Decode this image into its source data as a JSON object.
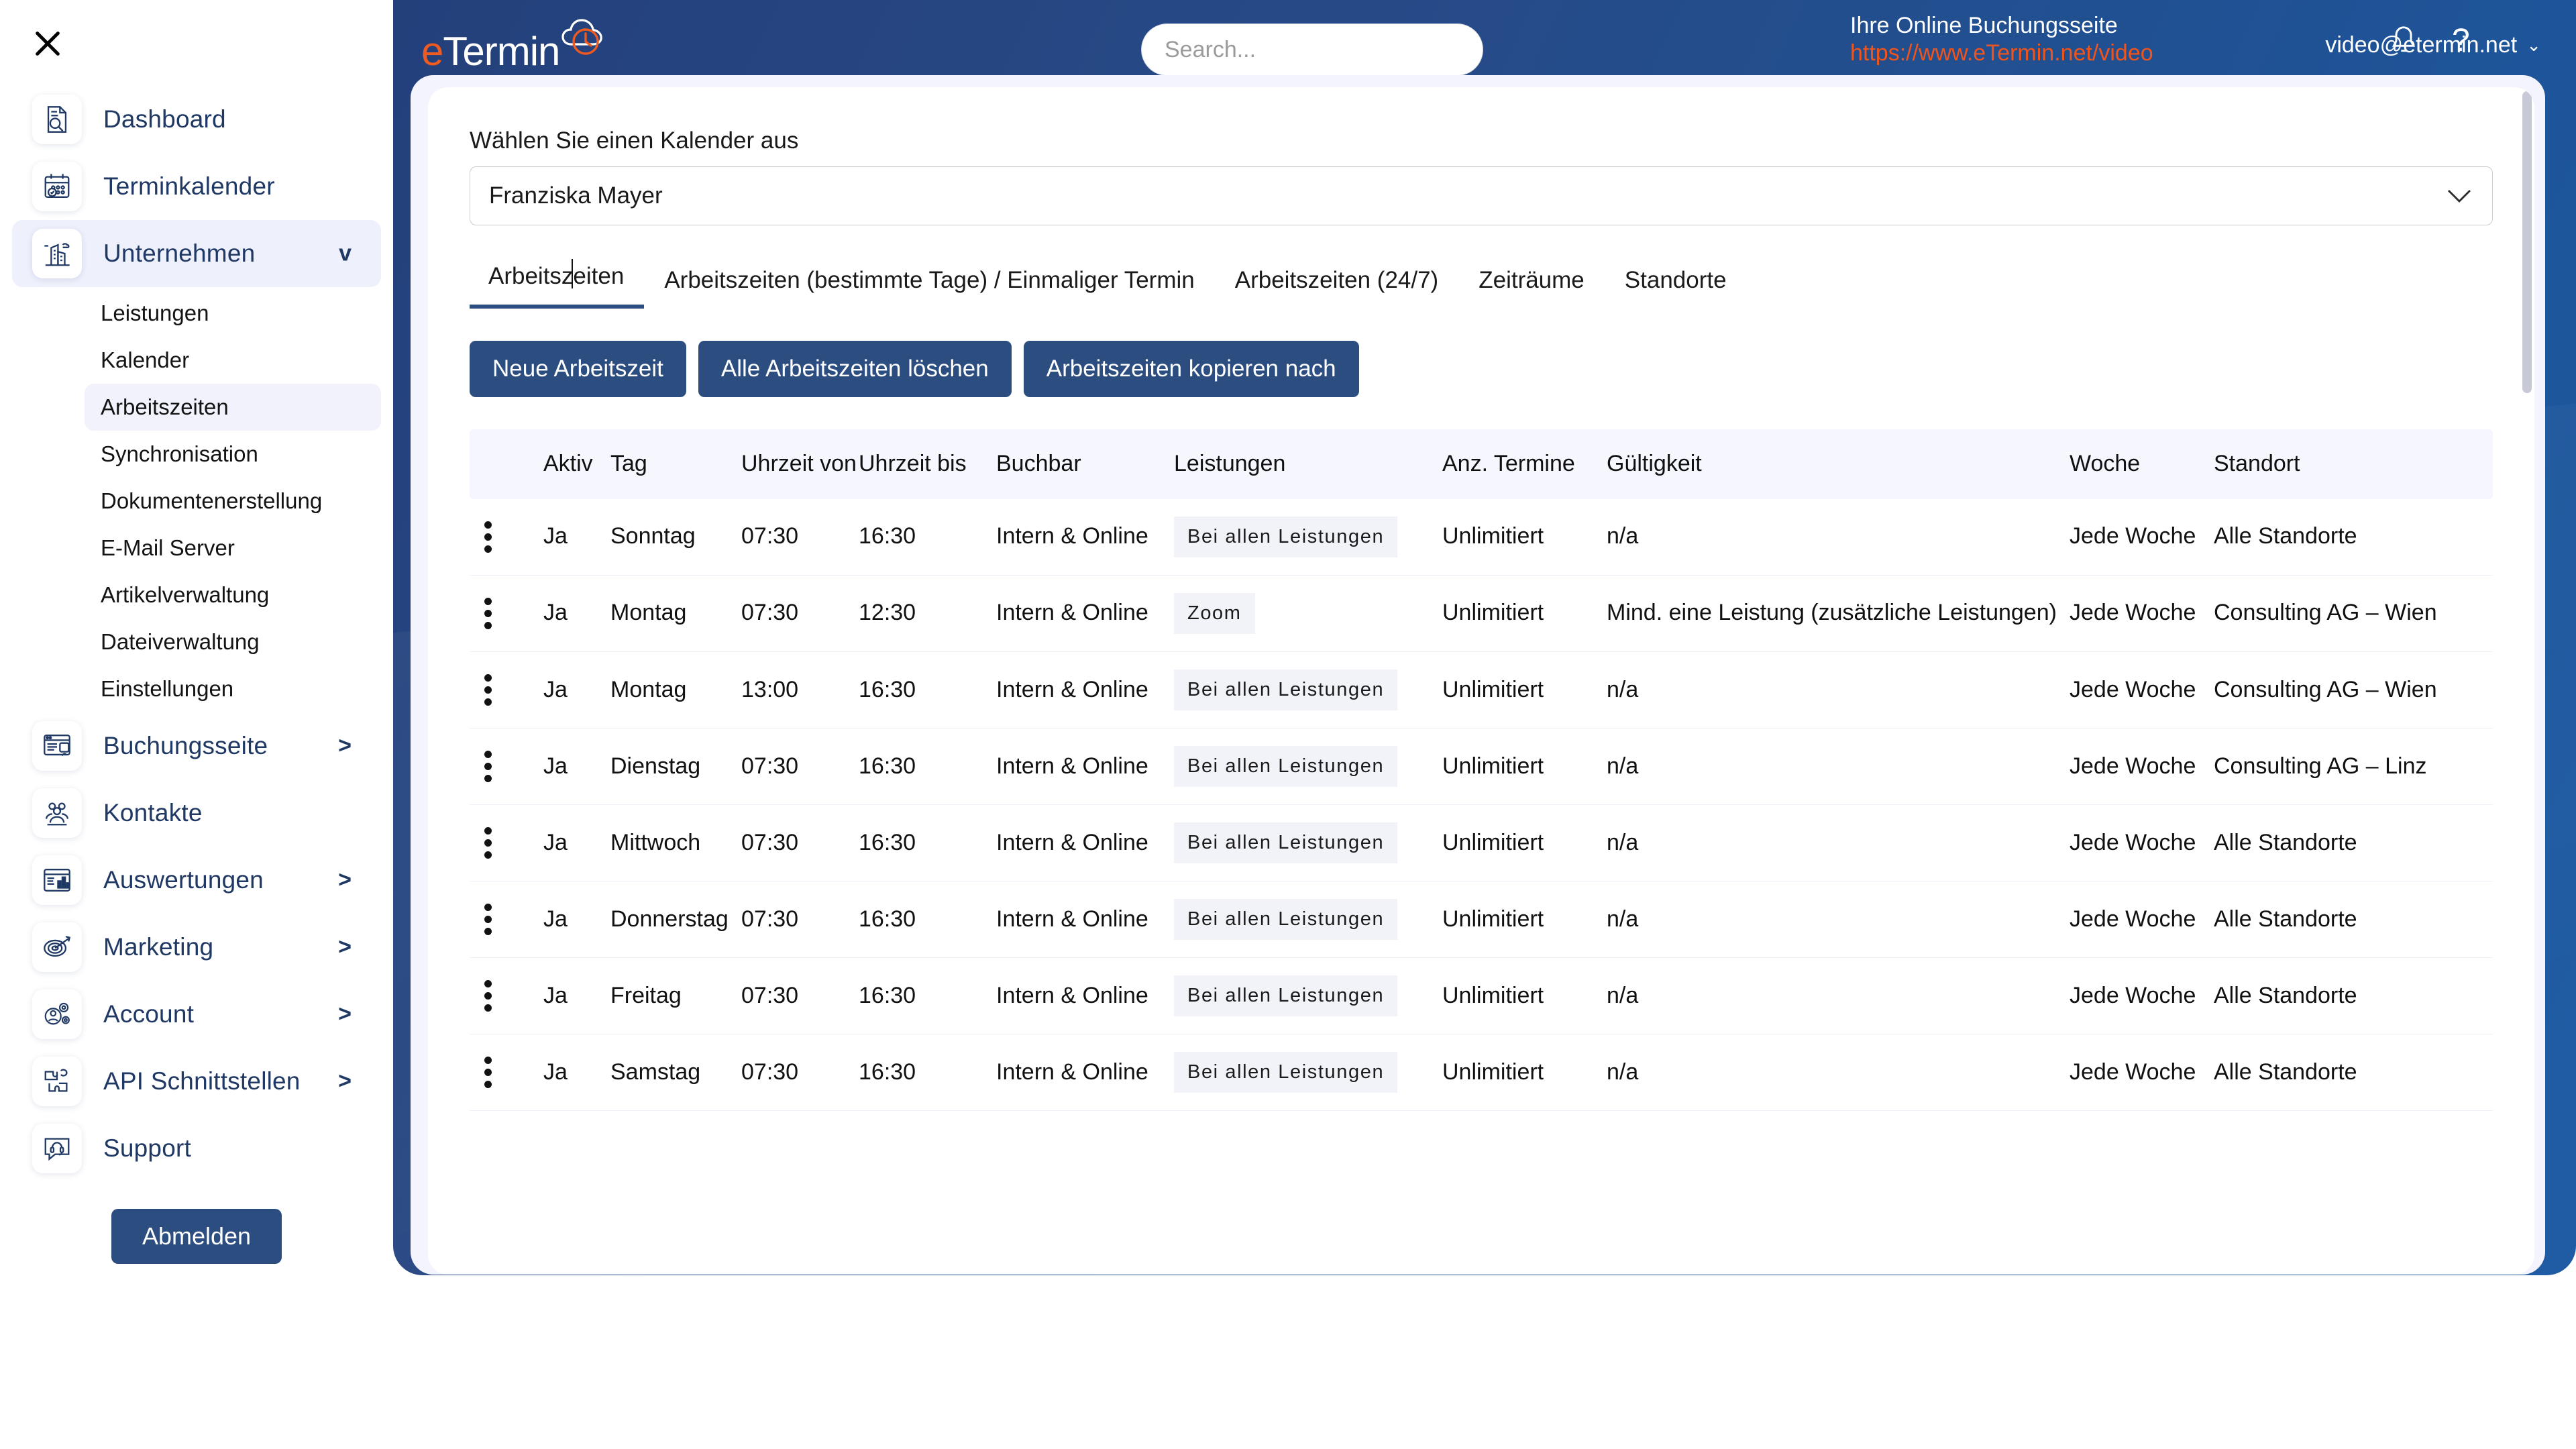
{
  "sidebar": {
    "close_icon": "close-icon",
    "items": [
      {
        "label": "Dashboard",
        "icon": "document-search-icon",
        "caret": "",
        "active": false
      },
      {
        "label": "Terminkalender",
        "icon": "calendar-check-icon",
        "caret": "",
        "active": false
      },
      {
        "label": "Unternehmen",
        "icon": "building-icon",
        "caret": "v",
        "active": true
      }
    ],
    "subitems": [
      {
        "label": "Leistungen",
        "active": false
      },
      {
        "label": "Kalender",
        "active": false
      },
      {
        "label": "Arbeitszeiten",
        "active": true
      },
      {
        "label": "Synchronisation",
        "active": false
      },
      {
        "label": "Dokumentenerstellung",
        "active": false
      },
      {
        "label": "E-Mail Server",
        "active": false
      },
      {
        "label": "Artikelverwaltung",
        "active": false
      },
      {
        "label": "Dateiverwaltung",
        "active": false
      },
      {
        "label": "Einstellungen",
        "active": false
      }
    ],
    "items2": [
      {
        "label": "Buchungsseite",
        "icon": "booking-page-icon",
        "caret": ">"
      },
      {
        "label": "Kontakte",
        "icon": "contacts-icon",
        "caret": ""
      },
      {
        "label": "Auswertungen",
        "icon": "analytics-icon",
        "caret": ">"
      },
      {
        "label": "Marketing",
        "icon": "target-icon",
        "caret": ">"
      },
      {
        "label": "Account",
        "icon": "account-gear-icon",
        "caret": ">"
      },
      {
        "label": "API Schnittstellen",
        "icon": "puzzle-icon",
        "caret": ">"
      },
      {
        "label": "Support",
        "icon": "headset-chat-icon",
        "caret": ""
      }
    ],
    "logout_label": "Abmelden"
  },
  "header": {
    "logo_e": "e",
    "logo_rest": "Termin",
    "search_placeholder": "Search...",
    "booking_title": "Ihre Online Buchungsseite",
    "booking_url": "https://www.eTermin.net/video",
    "bell_icon": "bell-icon",
    "help_icon": "?",
    "user_email": "video@etermin.net",
    "user_caret": "⌄",
    "colors": {
      "brand_blue": "#24407b",
      "accent_orange": "#ee5a1f",
      "link_orange": "#f1541a"
    }
  },
  "main": {
    "calendar_label": "Wählen Sie einen Kalender aus",
    "calendar_value": "Franziska Mayer",
    "tabs": [
      {
        "label": "Arbeitszeiten",
        "active": true
      },
      {
        "label": "Arbeitszeiten (bestimmte Tage) / Einmaliger Termin",
        "active": false
      },
      {
        "label": "Arbeitszeiten (24/7)",
        "active": false
      },
      {
        "label": "Zeiträume",
        "active": false
      },
      {
        "label": "Standorte",
        "active": false
      }
    ],
    "buttons": [
      {
        "label": "Neue Arbeitszeit"
      },
      {
        "label": "Alle Arbeitszeiten löschen"
      },
      {
        "label": "Arbeitszeiten kopieren nach"
      }
    ],
    "table": {
      "columns": [
        {
          "key": "menu",
          "label": ""
        },
        {
          "key": "aktiv",
          "label": "Aktiv"
        },
        {
          "key": "tag",
          "label": "Tag"
        },
        {
          "key": "von",
          "label": "Uhrzeit von"
        },
        {
          "key": "bis",
          "label": "Uhrzeit bis"
        },
        {
          "key": "buchbar",
          "label": "Buchbar"
        },
        {
          "key": "leist",
          "label": "Leistungen"
        },
        {
          "key": "anz",
          "label": "Anz. Termine"
        },
        {
          "key": "gult",
          "label": "Gültigkeit"
        },
        {
          "key": "woche",
          "label": "Woche"
        },
        {
          "key": "stand",
          "label": "Standort"
        }
      ],
      "rows": [
        {
          "aktiv": "Ja",
          "tag": "Sonntag",
          "von": "07:30",
          "bis": "16:30",
          "buchbar": "Intern & Online",
          "leistungen": "Bei allen Leistungen",
          "anz": "Unlimitiert",
          "gueltigkeit": "n/a",
          "woche": "Jede Woche",
          "standort": "Alle Standorte"
        },
        {
          "aktiv": "Ja",
          "tag": "Montag",
          "von": "07:30",
          "bis": "12:30",
          "buchbar": "Intern & Online",
          "leistungen": "Zoom",
          "anz": "Unlimitiert",
          "gueltigkeit": "Mind. eine Leistung (zusätzliche Leistungen)",
          "woche": "Jede Woche",
          "standort": "Consulting AG – Wien"
        },
        {
          "aktiv": "Ja",
          "tag": "Montag",
          "von": "13:00",
          "bis": "16:30",
          "buchbar": "Intern & Online",
          "leistungen": "Bei allen Leistungen",
          "anz": "Unlimitiert",
          "gueltigkeit": "n/a",
          "woche": "Jede Woche",
          "standort": "Consulting AG – Wien"
        },
        {
          "aktiv": "Ja",
          "tag": "Dienstag",
          "von": "07:30",
          "bis": "16:30",
          "buchbar": "Intern & Online",
          "leistungen": "Bei allen Leistungen",
          "anz": "Unlimitiert",
          "gueltigkeit": "n/a",
          "woche": "Jede Woche",
          "standort": "Consulting AG – Linz"
        },
        {
          "aktiv": "Ja",
          "tag": "Mittwoch",
          "von": "07:30",
          "bis": "16:30",
          "buchbar": "Intern & Online",
          "leistungen": "Bei allen Leistungen",
          "anz": "Unlimitiert",
          "gueltigkeit": "n/a",
          "woche": "Jede Woche",
          "standort": "Alle Standorte"
        },
        {
          "aktiv": "Ja",
          "tag": "Donnerstag",
          "von": "07:30",
          "bis": "16:30",
          "buchbar": "Intern & Online",
          "leistungen": "Bei allen Leistungen",
          "anz": "Unlimitiert",
          "gueltigkeit": "n/a",
          "woche": "Jede Woche",
          "standort": "Alle Standorte"
        },
        {
          "aktiv": "Ja",
          "tag": "Freitag",
          "von": "07:30",
          "bis": "16:30",
          "buchbar": "Intern & Online",
          "leistungen": "Bei allen Leistungen",
          "anz": "Unlimitiert",
          "gueltigkeit": "n/a",
          "woche": "Jede Woche",
          "standort": "Alle Standorte"
        },
        {
          "aktiv": "Ja",
          "tag": "Samstag",
          "von": "07:30",
          "bis": "16:30",
          "buchbar": "Intern & Online",
          "leistungen": "Bei allen Leistungen",
          "anz": "Unlimitiert",
          "gueltigkeit": "n/a",
          "woche": "Jede Woche",
          "standort": "Alle Standorte"
        }
      ]
    }
  }
}
